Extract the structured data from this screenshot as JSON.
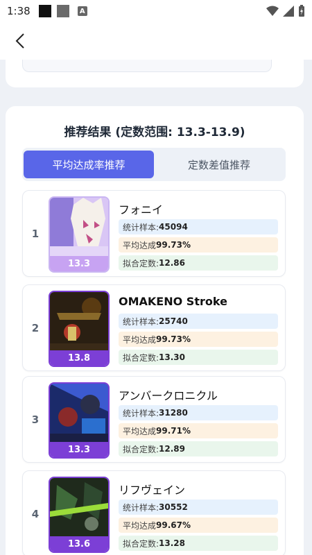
{
  "status_bar": {
    "time": "1:38",
    "notif_icon": "A"
  },
  "header": {
    "back_icon": "chevron-left"
  },
  "results": {
    "title": "推荐结果 (定数范围: 13.3-13.9)",
    "tabs": [
      {
        "label": "平均达成率推荐",
        "active": true
      },
      {
        "label": "定数差值推荐",
        "active": false
      }
    ],
    "stat_labels": {
      "samples": "统计样本:",
      "avg": "平均达成",
      "fit": "拟合定数:"
    },
    "items": [
      {
        "rank": "1",
        "title": "フォニイ",
        "level": "13.3",
        "samples": "45094",
        "avg_achievement": "99.73%",
        "fit_constant": "12.86"
      },
      {
        "rank": "2",
        "title": "OMAKENO Stroke",
        "level": "13.8",
        "samples": "25740",
        "avg_achievement": "99.73%",
        "fit_constant": "13.30"
      },
      {
        "rank": "3",
        "title": "アンバークロニクル",
        "level": "13.3",
        "samples": "31280",
        "avg_achievement": "99.71%",
        "fit_constant": "12.89"
      },
      {
        "rank": "4",
        "title": "リフヴェイン",
        "level": "13.6",
        "samples": "30552",
        "avg_achievement": "99.67%",
        "fit_constant": "13.28"
      }
    ]
  },
  "colors": {
    "accent": "#5966e8",
    "level_purple": "#7c3fd6",
    "level_light": "#c7a3f2"
  }
}
